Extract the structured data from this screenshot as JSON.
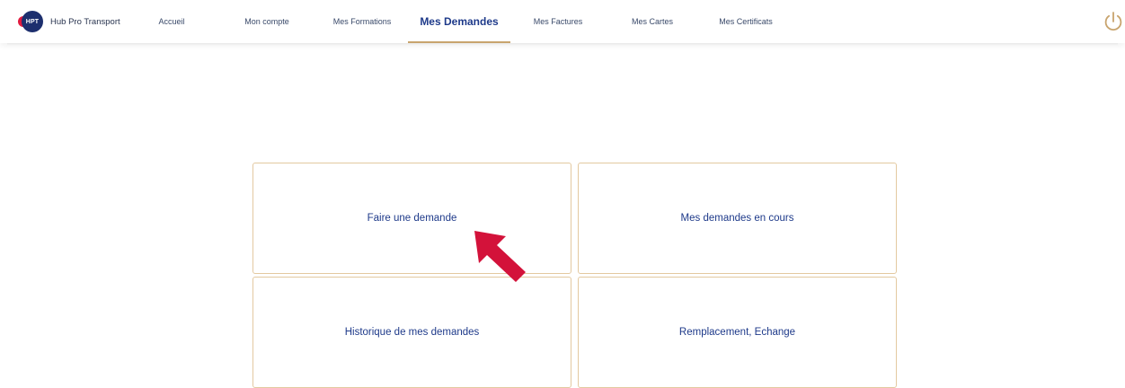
{
  "brand": {
    "logo_text": "HPT",
    "name": "Hub Pro Transport"
  },
  "nav": {
    "items": [
      {
        "label": "Accueil"
      },
      {
        "label": "Mon compte"
      },
      {
        "label": "Mes Formations"
      },
      {
        "label": "Mes Demandes",
        "active": true
      },
      {
        "label": "Mes Factures"
      },
      {
        "label": "Mes Cartes"
      },
      {
        "label": "Mes Certificats"
      }
    ]
  },
  "cards": [
    {
      "label": "Faire une demande"
    },
    {
      "label": "Mes demandes en cours"
    },
    {
      "label": "Historique de mes demandes"
    },
    {
      "label": "Remplacement, Echange"
    }
  ],
  "colors": {
    "accent": "#c8a46e",
    "brand_blue": "#1d2f6e",
    "brand_red": "#e21a3f",
    "arrow": "#d3123a"
  },
  "icons": {
    "power": "power-icon",
    "arrow": "red-arrow-icon"
  }
}
